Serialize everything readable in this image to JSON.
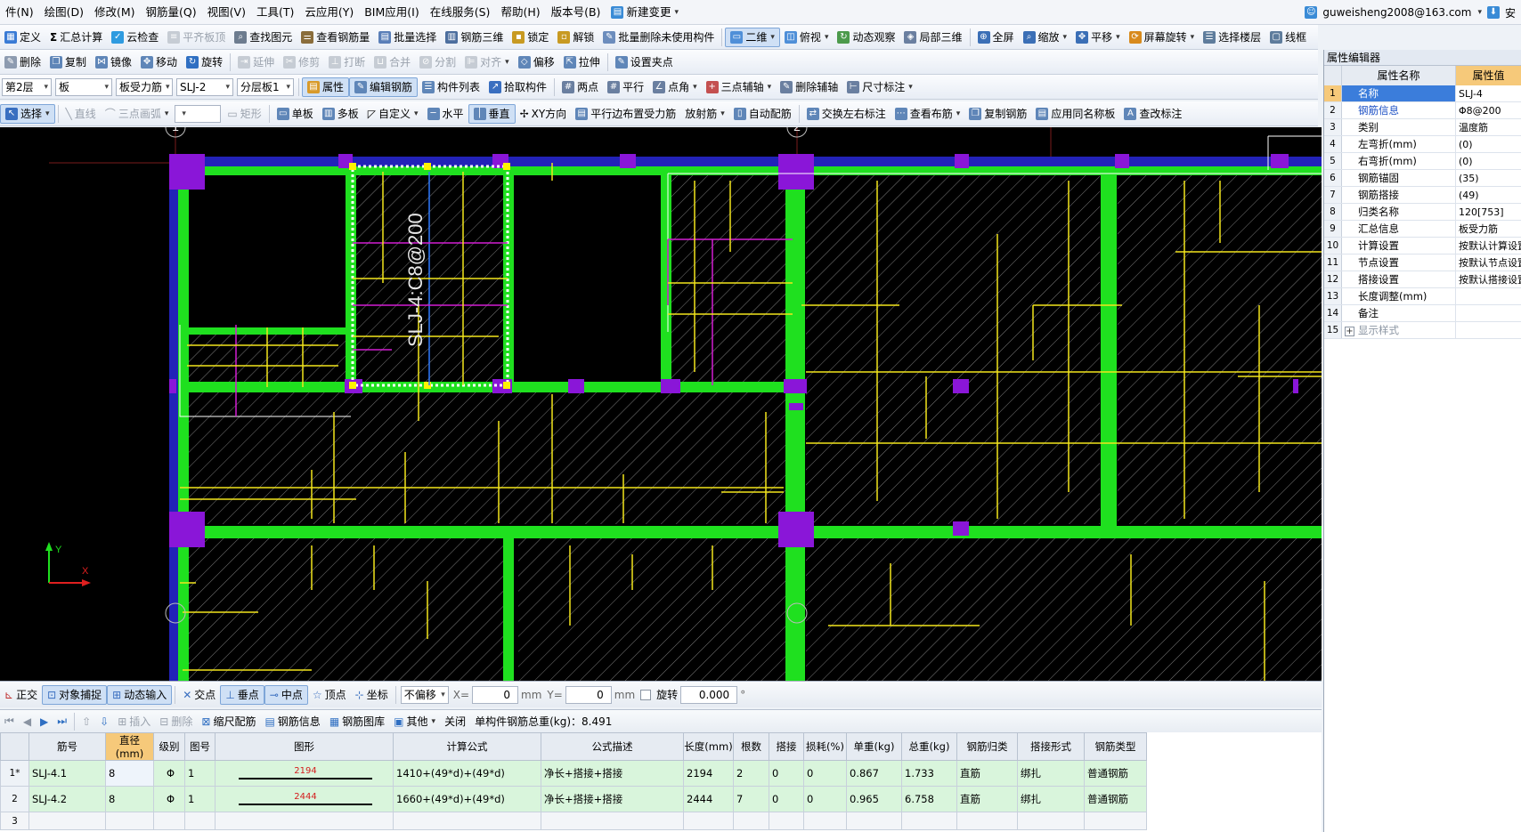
{
  "menu": {
    "items": [
      "件(N)",
      "绘图(D)",
      "修改(M)",
      "钢筋量(Q)",
      "视图(V)",
      "工具(T)",
      "云应用(Y)",
      "BIM应用(I)",
      "在线服务(S)",
      "帮助(H)",
      "版本号(B)"
    ],
    "new_change": "新建变更",
    "user": "guweisheng2008@163.com",
    "right_tail": "安"
  },
  "toolbar1": [
    "定义",
    "汇总计算",
    "云检查",
    "平齐板顶",
    "查找图元",
    "查看钢筋量",
    "批量选择",
    "钢筋三维",
    "锁定",
    "解锁",
    "批量删除未使用构件",
    "二维",
    "俯视",
    "动态观察",
    "局部三维",
    "全屏",
    "缩放",
    "平移",
    "屏幕旋转",
    "选择楼层",
    "线框"
  ],
  "toolbar2": [
    "删除",
    "复制",
    "镜像",
    "移动",
    "旋转",
    "延伸",
    "修剪",
    "打断",
    "合并",
    "分割",
    "对齐",
    "偏移",
    "拉伸",
    "设置夹点"
  ],
  "toolbar3": {
    "floor": "第2层",
    "category": "板",
    "type": "板受力筋",
    "name": "SLJ-2",
    "layer": "分层板1",
    "buttons": [
      "属性",
      "编辑钢筋",
      "构件列表",
      "拾取构件",
      "两点",
      "平行",
      "点角",
      "三点辅轴",
      "删除辅轴",
      "尺寸标注"
    ]
  },
  "toolbar4": {
    "select": "选择",
    "disabled": [
      "直线",
      "三点画弧",
      "矩形"
    ],
    "buttons": [
      "单板",
      "多板",
      "自定义",
      "水平",
      "垂直",
      "XY方向",
      "平行边布置受力筋",
      "放射筋",
      "自动配筋",
      "交换左右标注",
      "查看布筋",
      "复制钢筋",
      "应用同名称板",
      "查改标注"
    ]
  },
  "canvas": {
    "axis_labels": [
      "1",
      "2"
    ],
    "annotation": "SLJ-4:C8@200",
    "coord_x": "X",
    "coord_y": "Y"
  },
  "status": {
    "buttons": [
      "正交",
      "对象捕捉",
      "动态输入",
      "交点",
      "垂点",
      "中点",
      "顶点",
      "坐标"
    ],
    "offset_mode": "不偏移",
    "x_label": "X=",
    "x_value": "0",
    "y_label": "Y=",
    "y_value": "0",
    "unit": "mm",
    "rotate_label": "旋转",
    "rotate_value": "0.000",
    "deg": "°"
  },
  "rebar_toolbar": {
    "buttons": [
      "插入",
      "删除",
      "缩尺配筋",
      "钢筋信息",
      "钢筋图库",
      "其他",
      "关闭"
    ],
    "total": "单构件钢筋总重(kg)：8.491"
  },
  "rebar_table": {
    "headers": [
      "筋号",
      "直径(mm)",
      "级别",
      "图号",
      "图形",
      "计算公式",
      "公式描述",
      "长度(mm)",
      "根数",
      "搭接",
      "损耗(%)",
      "单重(kg)",
      "总重(kg)",
      "钢筋归类",
      "搭接形式",
      "钢筋类型"
    ],
    "rows": [
      {
        "rn": "1*",
        "no": "SLJ-4.1",
        "dia": "8",
        "grade": "Φ",
        "fig": "1",
        "shape_len": "2194",
        "formula": "1410+(49*d)+(49*d)",
        "desc": "净长+搭接+搭接",
        "length": "2194",
        "count": "2",
        "lap": "0",
        "loss": "0",
        "unit_w": "0.867",
        "total_w": "1.733",
        "cls": "直筋",
        "lap_form": "绑扎",
        "type": "普通钢筋"
      },
      {
        "rn": "2",
        "no": "SLJ-4.2",
        "dia": "8",
        "grade": "Φ",
        "fig": "1",
        "shape_len": "2444",
        "formula": "1660+(49*d)+(49*d)",
        "desc": "净长+搭接+搭接",
        "length": "2444",
        "count": "7",
        "lap": "0",
        "loss": "0",
        "unit_w": "0.965",
        "total_w": "6.758",
        "cls": "直筋",
        "lap_form": "绑扎",
        "type": "普通钢筋"
      }
    ],
    "empty_row": "3"
  },
  "property_editor": {
    "title": "属性编辑器",
    "col_name": "属性名称",
    "col_value": "属性值",
    "rows": [
      {
        "n": "1",
        "k": "名称",
        "v": "SLJ-4"
      },
      {
        "n": "2",
        "k": "钢筋信息",
        "v": "Φ8@200"
      },
      {
        "n": "3",
        "k": "类别",
        "v": "温度筋"
      },
      {
        "n": "4",
        "k": "左弯折(mm)",
        "v": "(0)"
      },
      {
        "n": "5",
        "k": "右弯折(mm)",
        "v": "(0)"
      },
      {
        "n": "6",
        "k": "钢筋锚固",
        "v": "(35)"
      },
      {
        "n": "7",
        "k": "钢筋搭接",
        "v": "(49)"
      },
      {
        "n": "8",
        "k": "归类名称",
        "v": "120[753]"
      },
      {
        "n": "9",
        "k": "汇总信息",
        "v": "板受力筋"
      },
      {
        "n": "10",
        "k": "计算设置",
        "v": "按默认计算设置"
      },
      {
        "n": "11",
        "k": "节点设置",
        "v": "按默认节点设置"
      },
      {
        "n": "12",
        "k": "搭接设置",
        "v": "按默认搭接设置"
      },
      {
        "n": "13",
        "k": "长度调整(mm)",
        "v": ""
      },
      {
        "n": "14",
        "k": "备注",
        "v": ""
      },
      {
        "n": "15",
        "k": "显示样式",
        "v": ""
      }
    ]
  }
}
